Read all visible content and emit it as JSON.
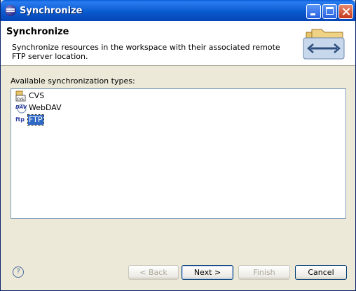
{
  "window": {
    "title": "Synchronize"
  },
  "header": {
    "title": "Synchronize",
    "description": "Synchronize resources in the workspace with their associated remote FTP server location."
  },
  "list": {
    "label": "Available synchronization types:",
    "items": [
      {
        "label": "CVS",
        "icon": "cvs-icon"
      },
      {
        "label": "WebDAV",
        "icon": "webdav-icon"
      },
      {
        "label": "FTP",
        "icon": "ftp-icon",
        "selected": true
      }
    ]
  },
  "buttons": {
    "help": "?",
    "back": "< Back",
    "next": "Next >",
    "finish": "Finish",
    "cancel": "Cancel"
  }
}
